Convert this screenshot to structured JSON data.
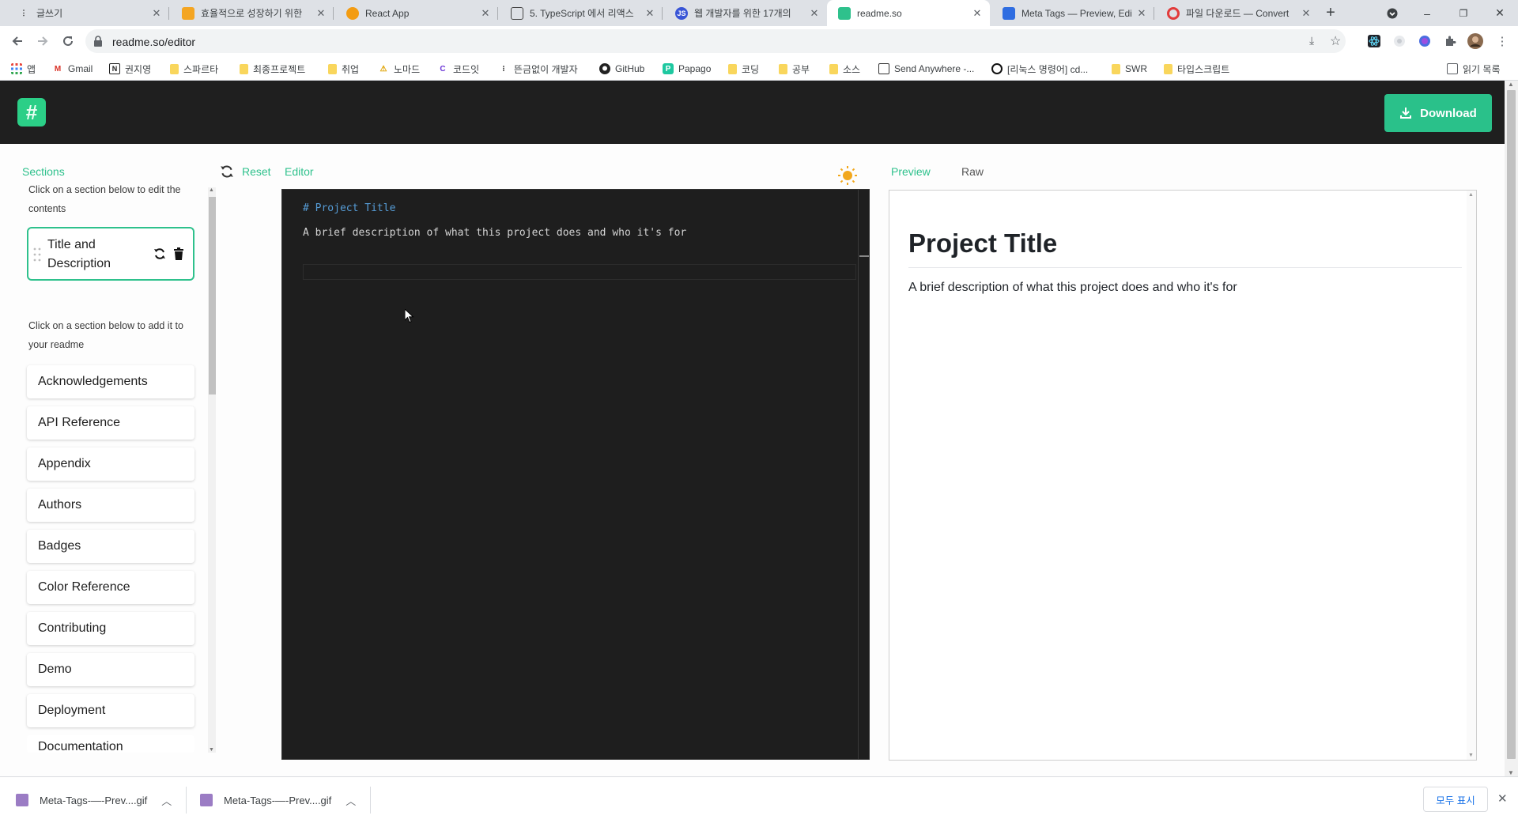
{
  "browser": {
    "tabs": [
      {
        "title": "글쓰기",
        "favicon_color": "#222222",
        "active": false
      },
      {
        "title": "효율적으로 성장하기 위한",
        "favicon_color": "#f4a522",
        "active": false
      },
      {
        "title": "React App",
        "favicon_color": "#f39c12",
        "active": false
      },
      {
        "title": "5. TypeScript 에서 리액스",
        "favicon_color": "#444444",
        "active": false
      },
      {
        "title": "웹 개발자를 위한 17개의",
        "favicon_color": "#3955d6",
        "active": false
      },
      {
        "title": "readme.so",
        "favicon_color": "#2ec18c",
        "active": true
      },
      {
        "title": "Meta Tags — Preview, Edi",
        "favicon_color": "#2f6de1",
        "active": false
      },
      {
        "title": "파일 다운로드 — Convert",
        "favicon_color": "#e23b3b",
        "active": false
      }
    ],
    "new_tab_label": "+",
    "url": "readme.so/editor",
    "bookmarks": [
      {
        "label": "앱",
        "icon": "apps-grid-icon"
      },
      {
        "label": "Gmail",
        "icon": "gmail-icon"
      },
      {
        "label": "권지영",
        "icon": "notion-icon"
      },
      {
        "label": "스파르타",
        "icon": "folder-icon"
      },
      {
        "label": "최종프로젝트",
        "icon": "folder-icon"
      },
      {
        "label": "취업",
        "icon": "folder-icon"
      },
      {
        "label": "노마드",
        "icon": "nomad-icon"
      },
      {
        "label": "코드잇",
        "icon": "codeit-icon"
      },
      {
        "label": "뜬금없이 개발자",
        "icon": "blog-icon"
      },
      {
        "label": "GitHub",
        "icon": "github-icon"
      },
      {
        "label": "Papago",
        "icon": "papago-icon"
      },
      {
        "label": "코딩",
        "icon": "folder-icon"
      },
      {
        "label": "공부",
        "icon": "folder-icon"
      },
      {
        "label": "소스",
        "icon": "folder-icon"
      },
      {
        "label": "Send Anywhere -...",
        "icon": "sendanywhere-icon"
      },
      {
        "label": "[리눅스 명령어] cd...",
        "icon": "circle-icon"
      },
      {
        "label": "SWR",
        "icon": "folder-icon"
      },
      {
        "label": "타입스크립트",
        "icon": "folder-icon"
      }
    ],
    "reading_list_label": "읽기 목록"
  },
  "app": {
    "logo_glyph": "#",
    "download_label": "Download",
    "sections_label": "Sections",
    "edit_hint": "Click on a section below to edit the contents",
    "active_section": "Title and Description",
    "add_hint": "Click on a section below to add it to your readme",
    "available_sections": [
      "Acknowledgements",
      "API Reference",
      "Appendix",
      "Authors",
      "Badges",
      "Color Reference",
      "Contributing",
      "Demo",
      "Deployment",
      "Documentation"
    ],
    "reset_label": "Reset",
    "editor_label": "Editor",
    "preview_label": "Preview",
    "raw_label": "Raw",
    "editor_lines": [
      "# Project Title",
      "A brief description of what this project does and who it's for"
    ],
    "preview_title": "Project Title",
    "preview_body": "A brief description of what this project does and who it's for",
    "accent_color": "#2ec18c"
  },
  "downloads": {
    "items": [
      "Meta-Tags-—-Prev....gif",
      "Meta-Tags-—-Prev....gif"
    ],
    "show_all_label": "모두 표시"
  }
}
